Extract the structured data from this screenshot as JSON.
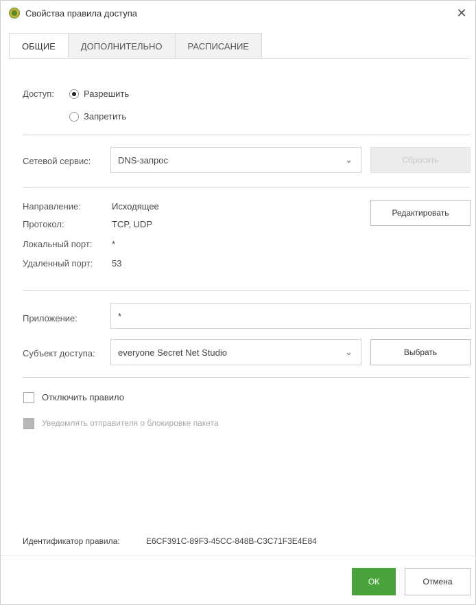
{
  "window": {
    "title": "Свойства правила доступа",
    "close_glyph": "✕"
  },
  "tabs": [
    {
      "label": "ОБЩИЕ",
      "active": true
    },
    {
      "label": "ДОПОЛНИТЕЛЬНО",
      "active": false
    },
    {
      "label": "РАСПИСАНИЕ",
      "active": false
    }
  ],
  "access": {
    "label": "Доступ:",
    "options": [
      {
        "label": "Разрешить",
        "checked": true
      },
      {
        "label": "Запретить",
        "checked": false
      }
    ]
  },
  "network_service": {
    "label": "Сетевой сервис:",
    "value": "DNS-запрос",
    "reset_button": "Сбросить"
  },
  "details": {
    "edit_button": "Редактировать",
    "rows": [
      {
        "label": "Направление:",
        "value": "Исходящее"
      },
      {
        "label": "Протокол:",
        "value": "TCP, UDP"
      },
      {
        "label": "Локальный порт:",
        "value": "*"
      },
      {
        "label": "Удаленный порт:",
        "value": "53"
      }
    ]
  },
  "application": {
    "label": "Приложение:",
    "value": "*"
  },
  "subject": {
    "label": "Субъект доступа:",
    "value": "everyone Secret Net Studio",
    "choose_button": "Выбрать"
  },
  "options": {
    "disable_rule": {
      "label": "Отключить правило",
      "checked": false,
      "enabled": true
    },
    "notify_sender": {
      "label": "Уведомлять отправителя о блокировке пакета",
      "checked": false,
      "enabled": false
    }
  },
  "rule_id": {
    "label": "Идентификатор правила:",
    "value": "E6CF391C-89F3-45CC-848B-C3C71F3E4E84"
  },
  "footer": {
    "ok_button": "ОК",
    "cancel_button": "Отмена"
  },
  "colors": {
    "accent": "#49a33a",
    "separator": "#cfcfcf"
  }
}
